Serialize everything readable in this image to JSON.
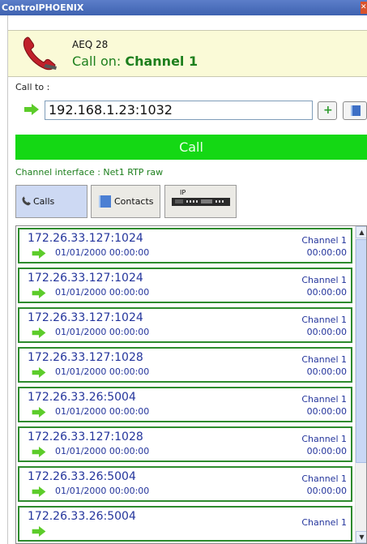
{
  "window": {
    "title": "ControlPHOENIX",
    "close_icon": "close-icon"
  },
  "call_info": {
    "phone_icon": "phone-handset-icon",
    "device": "AEQ 28",
    "status_prefix": "Call on: ",
    "channel": "Channel 1"
  },
  "call_to": {
    "label": "Call to :",
    "value": "192.168.1.23:1032",
    "add_label": "+",
    "book_icon": "address-book-icon"
  },
  "call_button": {
    "label": "Call",
    "color": "#14d814"
  },
  "channel_interface": "Channel interface : Net1 RTP raw",
  "tabs": {
    "calls": "Calls",
    "contacts": "Contacts",
    "ip_label": "IP"
  },
  "calls": [
    {
      "address": "172.26.33.127:1024",
      "channel": "Channel 1",
      "datetime": "01/01/2000 00:00:00",
      "duration": "00:00:00"
    },
    {
      "address": "172.26.33.127:1024",
      "channel": "Channel 1",
      "datetime": "01/01/2000 00:00:00",
      "duration": "00:00:00"
    },
    {
      "address": "172.26.33.127:1024",
      "channel": "Channel 1",
      "datetime": "01/01/2000 00:00:00",
      "duration": "00:00:00"
    },
    {
      "address": "172.26.33.127:1028",
      "channel": "Channel 1",
      "datetime": "01/01/2000 00:00:00",
      "duration": "00:00:00"
    },
    {
      "address": "172.26.33.26:5004",
      "channel": "Channel 1",
      "datetime": "01/01/2000 00:00:00",
      "duration": "00:00:00"
    },
    {
      "address": "172.26.33.127:1028",
      "channel": "Channel 1",
      "datetime": "01/01/2000 00:00:00",
      "duration": "00:00:00"
    },
    {
      "address": "172.26.33.26:5004",
      "channel": "Channel 1",
      "datetime": "01/01/2000 00:00:00",
      "duration": "00:00:00"
    },
    {
      "address": "172.26.33.26:5004",
      "channel": "Channel 1",
      "datetime": "",
      "duration": ""
    }
  ],
  "colors": {
    "accent_green": "#1d7f1d",
    "call_text_blue": "#24359c"
  }
}
